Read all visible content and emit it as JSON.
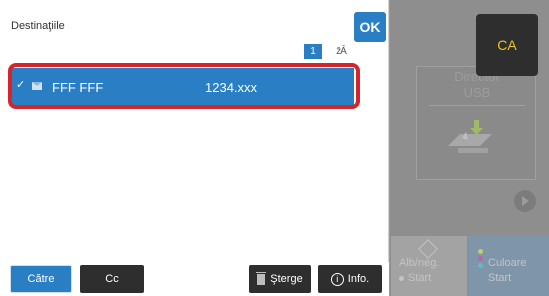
{
  "dialog": {
    "title": "Destinaţiile",
    "ok_label": "OK",
    "page_number": "1",
    "sort_glyph": "z̄Ā"
  },
  "destinations": [
    {
      "name": "FFF FFF",
      "address": "1234.xxx",
      "selected": true
    }
  ],
  "bottom_bar": {
    "to_label": "Către",
    "cc_label": "Cc",
    "delete_label": "Şterge",
    "info_label": "Info."
  },
  "side": {
    "ca_label": "CA",
    "document_label": "Director\nUSB",
    "start_bw_line1": "Alb/neg.",
    "start_bw_line2": "Start",
    "start_color_line1": "Culoare",
    "start_color_line2": "Start"
  },
  "colors": {
    "accent": "#2a7fc4",
    "highlight": "#d5242b",
    "ca_text": "#f2c21c"
  }
}
